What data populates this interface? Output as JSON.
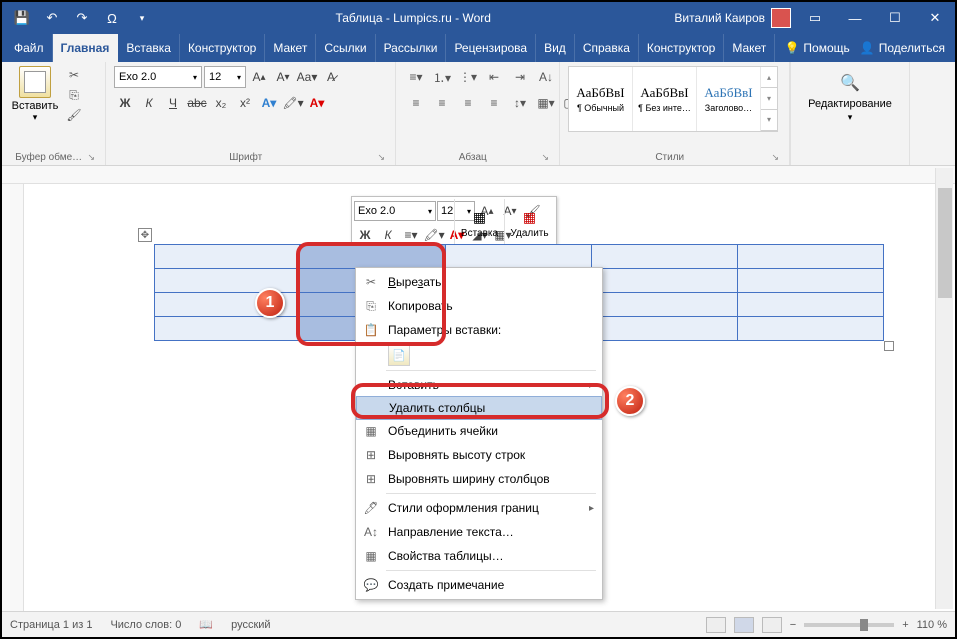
{
  "title": "Таблица - Lumpics.ru  -  Word",
  "user_name": "Виталий Каиров",
  "tabs": {
    "file": "Файл",
    "home": "Главная",
    "insert": "Вставка",
    "design": "Конструктор",
    "layout": "Макет",
    "references": "Ссылки",
    "mail": "Рассылки",
    "review": "Рецензирова",
    "view": "Вид",
    "help_tab": "Справка",
    "table_design": "Конструктор",
    "table_layout": "Макет",
    "tell_me": "Помощь",
    "share": "Поделиться"
  },
  "ribbon": {
    "clipboard": {
      "paste": "Вставить",
      "group": "Буфер обме…"
    },
    "font": {
      "name": "Exo 2.0",
      "size": "12",
      "group": "Шрифт",
      "bold": "Ж",
      "italic": "К",
      "underline": "Ч"
    },
    "paragraph": {
      "group": "Абзац"
    },
    "styles": {
      "preview": "АаБбВвІ",
      "s1": "¶ Обычный",
      "s2": "¶ Без инте…",
      "s3": "Заголово…",
      "group": "Стили"
    },
    "edit": {
      "label": "Редактирование"
    }
  },
  "mini": {
    "font": "Exo 2.0",
    "size": "12",
    "insert": "Вставка",
    "delete": "Удалить",
    "bold": "Ж",
    "italic": "К"
  },
  "context": {
    "cut": "Вырезать",
    "copy": "Копировать",
    "paste_opts": "Параметры вставки:",
    "insert": "Вставить",
    "delete_cols": "Удалить столбцы",
    "merge": "Объединить ячейки",
    "dist_rows": "Выровнять высоту строк",
    "dist_cols": "Выровнять ширину столбцов",
    "border_styles": "Стили оформления границ",
    "text_dir": "Направление текста…",
    "table_props": "Свойства таблицы…",
    "comment": "Создать примечание"
  },
  "status": {
    "page": "Страница  1 из 1",
    "words": "Число слов:  0",
    "lang": "русский",
    "zoom": "110 %"
  }
}
